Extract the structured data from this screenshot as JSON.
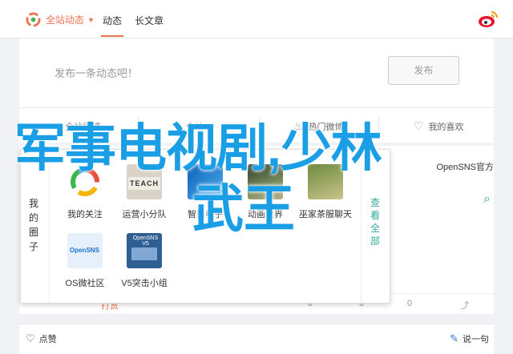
{
  "topbar": {
    "scope_label": "全站动态",
    "tabs": [
      {
        "label": "动态"
      },
      {
        "label": "长文章"
      }
    ]
  },
  "composer": {
    "placeholder": "发布一条动态吧！",
    "post_label": "发布"
  },
  "actions": [
    {
      "label": "全站微博"
    },
    {
      "label": "全站"
    },
    {
      "label": "热门微博"
    },
    {
      "label": "我的喜欢"
    }
  ],
  "feed": {
    "author": "OpenSNS官方",
    "like_action": "打赏",
    "stats": [
      {
        "label": "0"
      },
      {
        "label": "0"
      },
      {
        "label": "0"
      }
    ],
    "bottom_like": "点赞",
    "bottom_say": "说一句"
  },
  "panel": {
    "side_label": "我的圈子",
    "view_all": "查看全部",
    "apps": [
      {
        "name": "我的关注"
      },
      {
        "name": "运营小分队"
      },
      {
        "name": "智果电子"
      },
      {
        "name": "动画世界"
      },
      {
        "name": "巫家茶服聊天"
      },
      {
        "name": "OS微社区"
      },
      {
        "name": "V5突击小组"
      }
    ],
    "thumb_text": {
      "teach": "TEACH",
      "os": "OpenSNS",
      "v5": "OpenSNS V5"
    }
  },
  "overlay": {
    "line1": "军事电视剧,少林",
    "line2": "武王"
  },
  "colors": {
    "accent": "#eb7350",
    "link": "#33aa99",
    "overlay": "#1a9ee6"
  }
}
